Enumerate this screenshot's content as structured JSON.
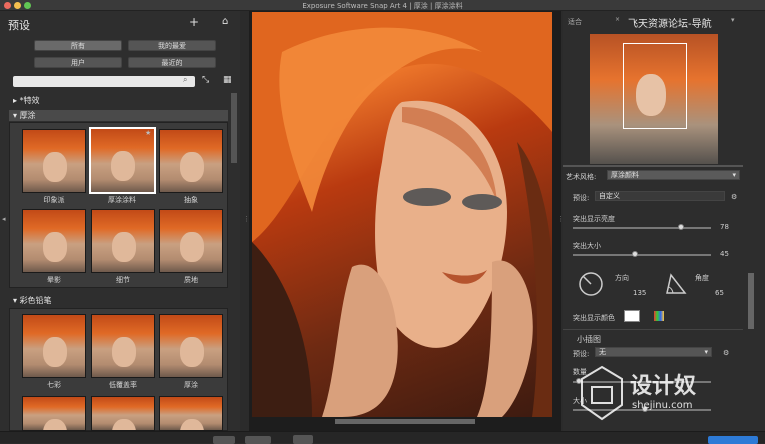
{
  "window": {
    "title": "Exposure Software Snap Art 4 | 厚涂 | 厚涂涂料"
  },
  "presets_panel": {
    "title": "预设",
    "add_icon": "plus-icon",
    "home_icon": "home-icon",
    "filters": [
      "所有",
      "我的最爱",
      "用户",
      "最近的"
    ],
    "search_placeholder": "",
    "sections": [
      {
        "name": "*特效",
        "collapsed": true
      },
      {
        "name": "厚涂",
        "collapsed": false,
        "items": [
          "印象派",
          "厚涂涂料",
          "抽象",
          "晕影",
          "细节",
          "质地"
        ]
      },
      {
        "name": "彩色铅笔",
        "collapsed": false,
        "items": [
          "七彩",
          "低覆盖率",
          "厚涂",
          "",
          "",
          ""
        ]
      }
    ]
  },
  "right_panel": {
    "tabs": [
      "适合",
      "飞天资源论坛-导航"
    ],
    "style_label": "艺术风格:",
    "style_value": "厚涂颜料",
    "preset_label": "预设:",
    "preset_value": "自定义",
    "highlight_brightness": {
      "label": "突出显示亮度",
      "value": "78",
      "fraction": 0.78
    },
    "highlight_size": {
      "label": "突出大小",
      "value": "45",
      "fraction": 0.45
    },
    "direction": {
      "label": "方向",
      "value": "135"
    },
    "angle": {
      "label": "角度",
      "value": "65"
    },
    "highlight_color_label": "突出显示颜色",
    "highlight_color": "#ffffff",
    "small_illus_label": "小插图",
    "small_preset_label": "预设:",
    "small_preset_value": "无",
    "count_label": "数量",
    "size_label": "大小"
  },
  "watermark": {
    "text": "设计奴",
    "url": "shejinu.com"
  }
}
